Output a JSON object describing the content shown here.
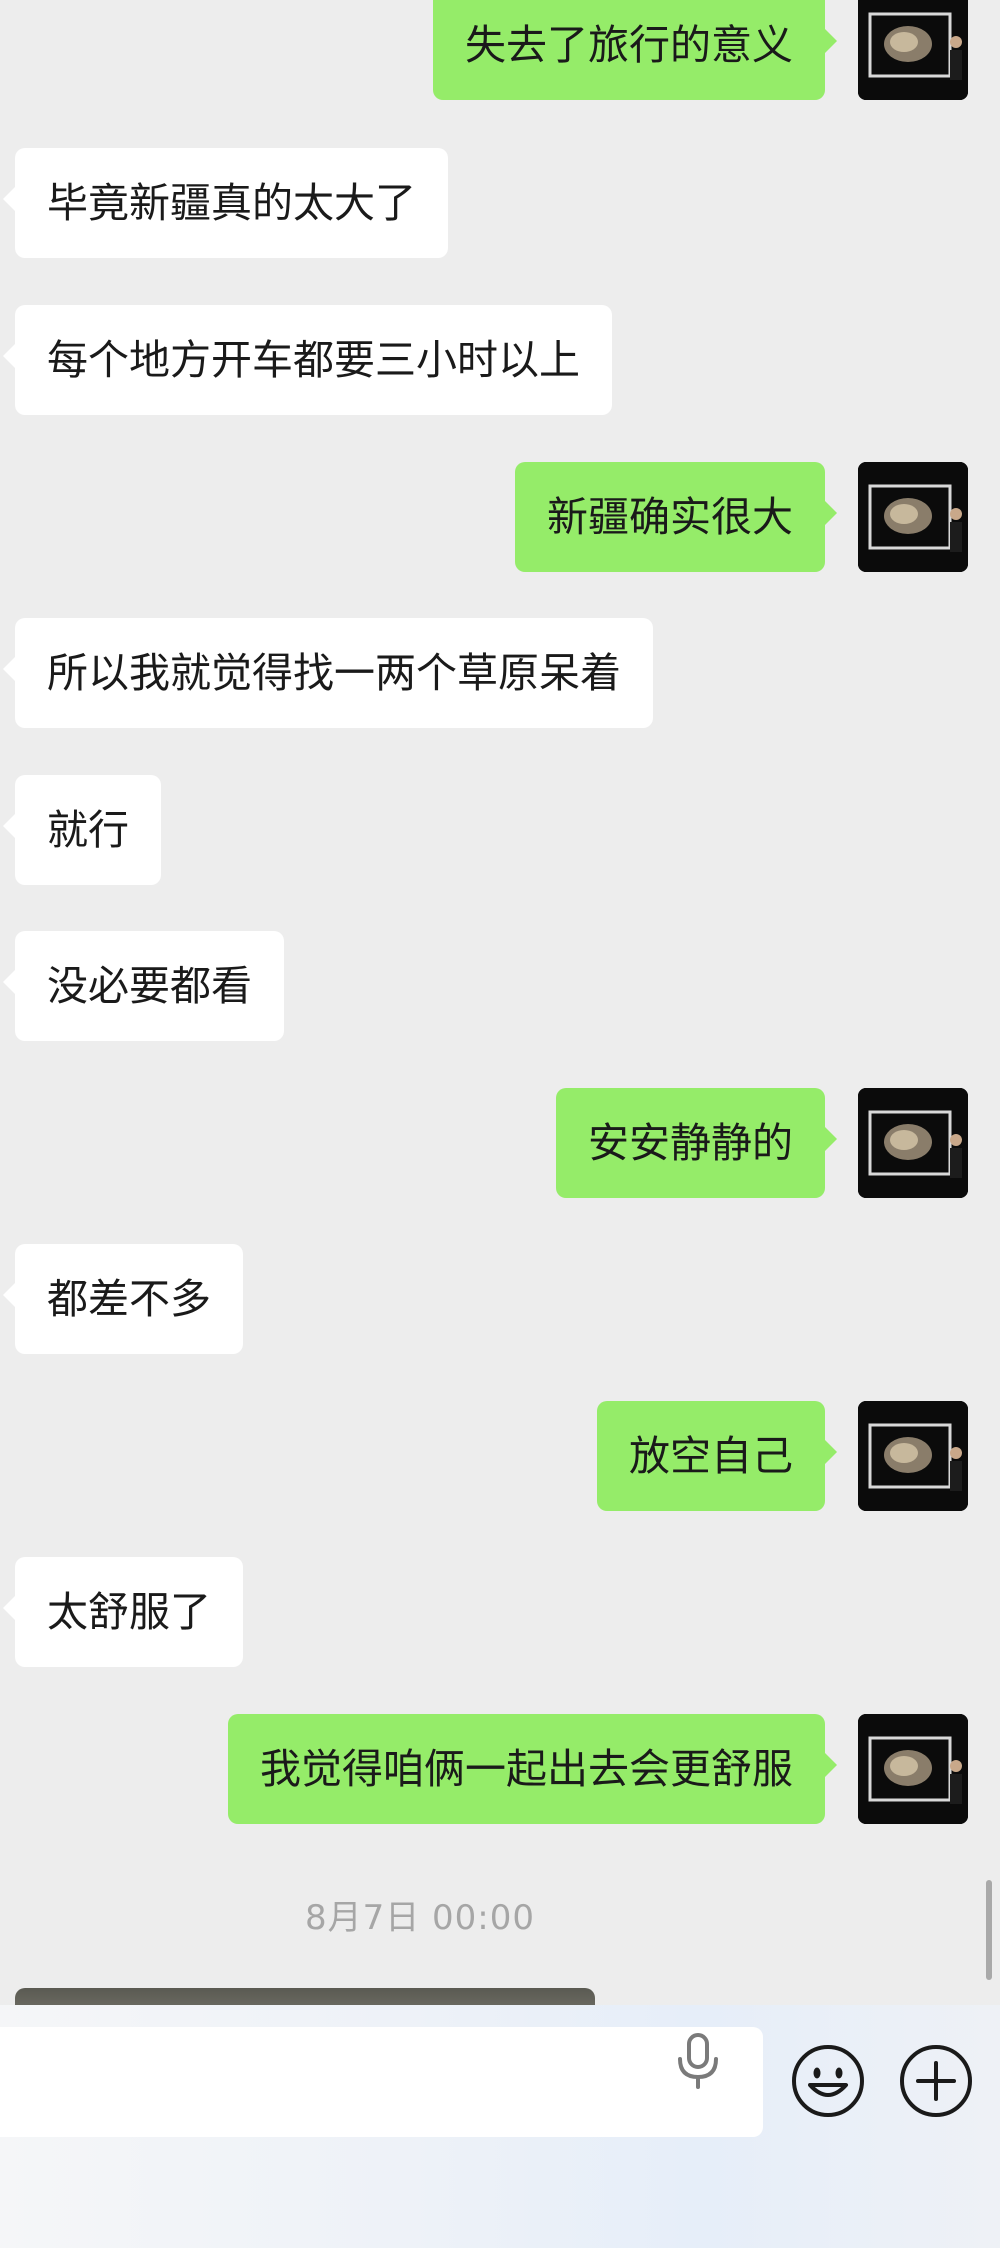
{
  "messages": [
    {
      "side": "out",
      "text": "失去了旅行的意义"
    },
    {
      "side": "in",
      "text": "毕竟新疆真的太大了"
    },
    {
      "side": "in",
      "text": "每个地方开车都要三小时以上"
    },
    {
      "side": "out",
      "text": "新疆确实很大"
    },
    {
      "side": "in",
      "text": "所以我就觉得找一两个草原呆着"
    },
    {
      "side": "in",
      "text": "就行"
    },
    {
      "side": "in",
      "text": "没必要都看"
    },
    {
      "side": "out",
      "text": "安安静静的"
    },
    {
      "side": "in",
      "text": "都差不多"
    },
    {
      "side": "out",
      "text": "放空自己"
    },
    {
      "side": "in",
      "text": "太舒服了"
    },
    {
      "side": "out",
      "text": "我觉得咱俩一起出去会更舒服"
    }
  ],
  "timestamp": "8月7日 00:00",
  "input": {
    "placeholder": ""
  },
  "icons": {
    "mic": "microphone-icon",
    "emoji": "emoji-icon",
    "plus": "plus-icon"
  },
  "colors": {
    "background": "#ededed",
    "incoming_bubble": "#ffffff",
    "outgoing_bubble": "#95ec69",
    "timestamp_text": "#a6a6a6"
  }
}
